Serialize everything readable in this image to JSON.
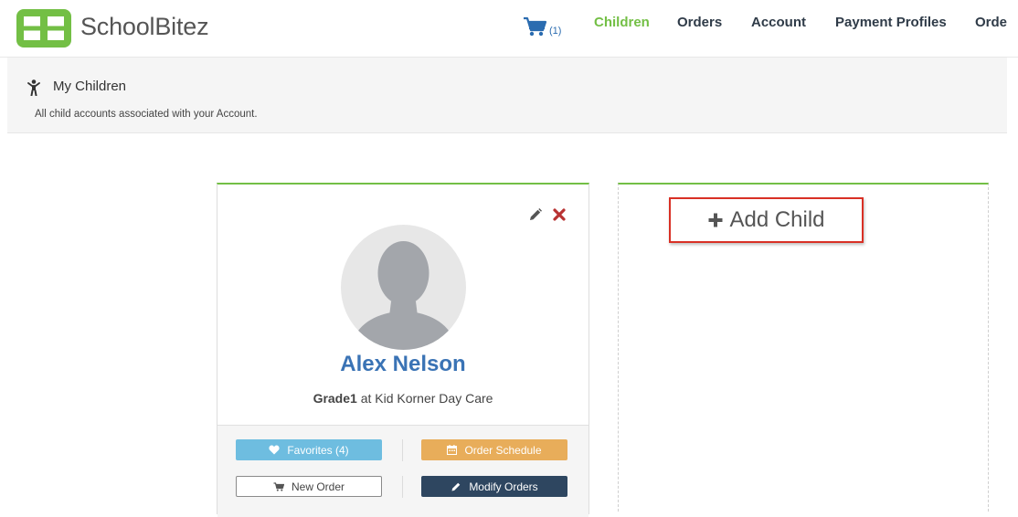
{
  "header": {
    "brand": "SchoolBitez",
    "cart_count": "(1)",
    "nav": [
      {
        "label": "Children",
        "active": true
      },
      {
        "label": "Orders",
        "active": false
      },
      {
        "label": "Account",
        "active": false
      },
      {
        "label": "Payment Profiles",
        "active": false
      },
      {
        "label": "Orde",
        "active": false
      }
    ]
  },
  "subheader": {
    "title": "My Children",
    "description": "All child accounts associated with your Account."
  },
  "child": {
    "name": "Alex Nelson",
    "grade": "Grade1",
    "grade_suffix": " at Kid Korner Day Care"
  },
  "buttons": {
    "favorites": "Favorites (4)",
    "order_schedule": "Order Schedule",
    "new_order": "New Order",
    "modify_orders": "Modify Orders"
  },
  "add_child": {
    "label": "Add Child"
  },
  "colors": {
    "accent_green": "#73bf45",
    "name_blue": "#3a73b5",
    "favorites_blue": "#6ebde0",
    "schedule_orange": "#e8ad5a",
    "modify_navy": "#2e4660",
    "highlight_red": "#d93025"
  },
  "icons": {
    "logo": "schoolbitez-logo-icon",
    "cart": "cart-icon",
    "children": "child-icon",
    "edit": "pencil-icon",
    "delete": "close-icon",
    "avatar": "avatar-placeholder-icon",
    "favorites": "heart-icon",
    "schedule": "calendar-icon",
    "new_order": "cart-icon",
    "modify": "pencil-icon",
    "add": "plus-icon"
  }
}
